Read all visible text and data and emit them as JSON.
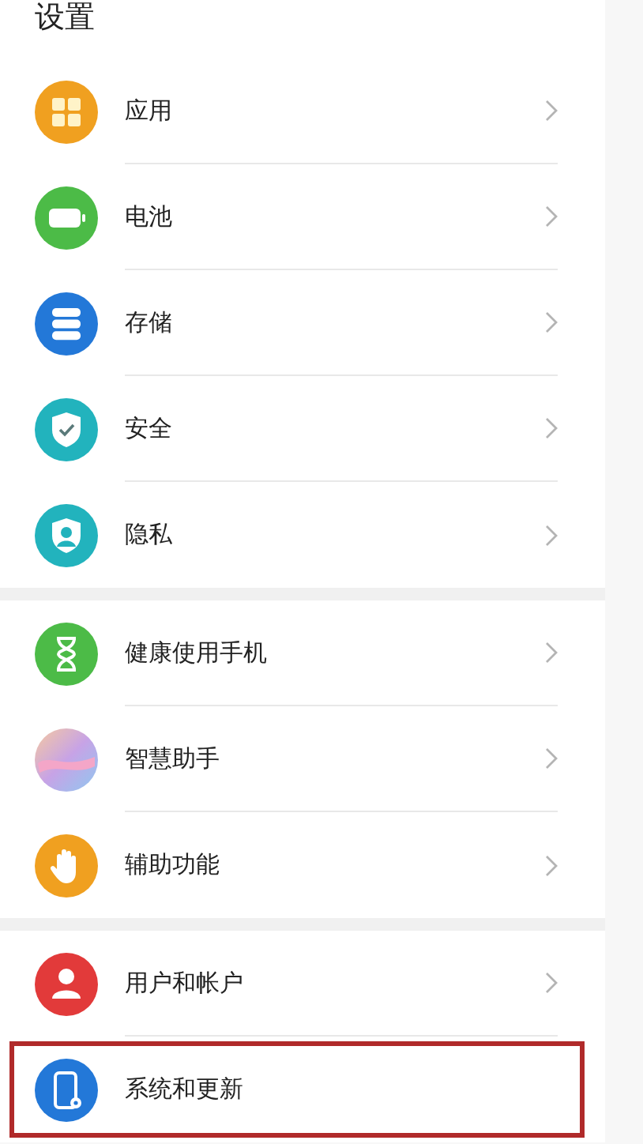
{
  "title": "设置",
  "groups": [
    {
      "items": [
        {
          "label": "应用",
          "kind": "apps",
          "color": "#f0a020",
          "chevron": true,
          "highlighted": false
        },
        {
          "label": "电池",
          "kind": "battery",
          "color": "#4cbb47",
          "chevron": true,
          "highlighted": false
        },
        {
          "label": "存储",
          "kind": "storage",
          "color": "#2378d8",
          "chevron": true,
          "highlighted": false
        },
        {
          "label": "安全",
          "kind": "security",
          "color": "#22b3bd",
          "chevron": true,
          "highlighted": false
        },
        {
          "label": "隐私",
          "kind": "privacy",
          "color": "#22b3bd",
          "chevron": true,
          "highlighted": false
        }
      ]
    },
    {
      "items": [
        {
          "label": "健康使用手机",
          "kind": "hourglass",
          "color": "#4cbb47",
          "chevron": true,
          "highlighted": false
        },
        {
          "label": "智慧助手",
          "kind": "assistant",
          "color": "#c7a3e6",
          "chevron": true,
          "highlighted": false
        },
        {
          "label": "辅助功能",
          "kind": "hand",
          "color": "#f0a020",
          "chevron": true,
          "highlighted": false
        }
      ]
    },
    {
      "items": [
        {
          "label": "用户和帐户",
          "kind": "user",
          "color": "#e23a3a",
          "chevron": true,
          "highlighted": false
        },
        {
          "label": "系统和更新",
          "kind": "phone",
          "color": "#2378d8",
          "chevron": false,
          "highlighted": true
        }
      ]
    }
  ]
}
